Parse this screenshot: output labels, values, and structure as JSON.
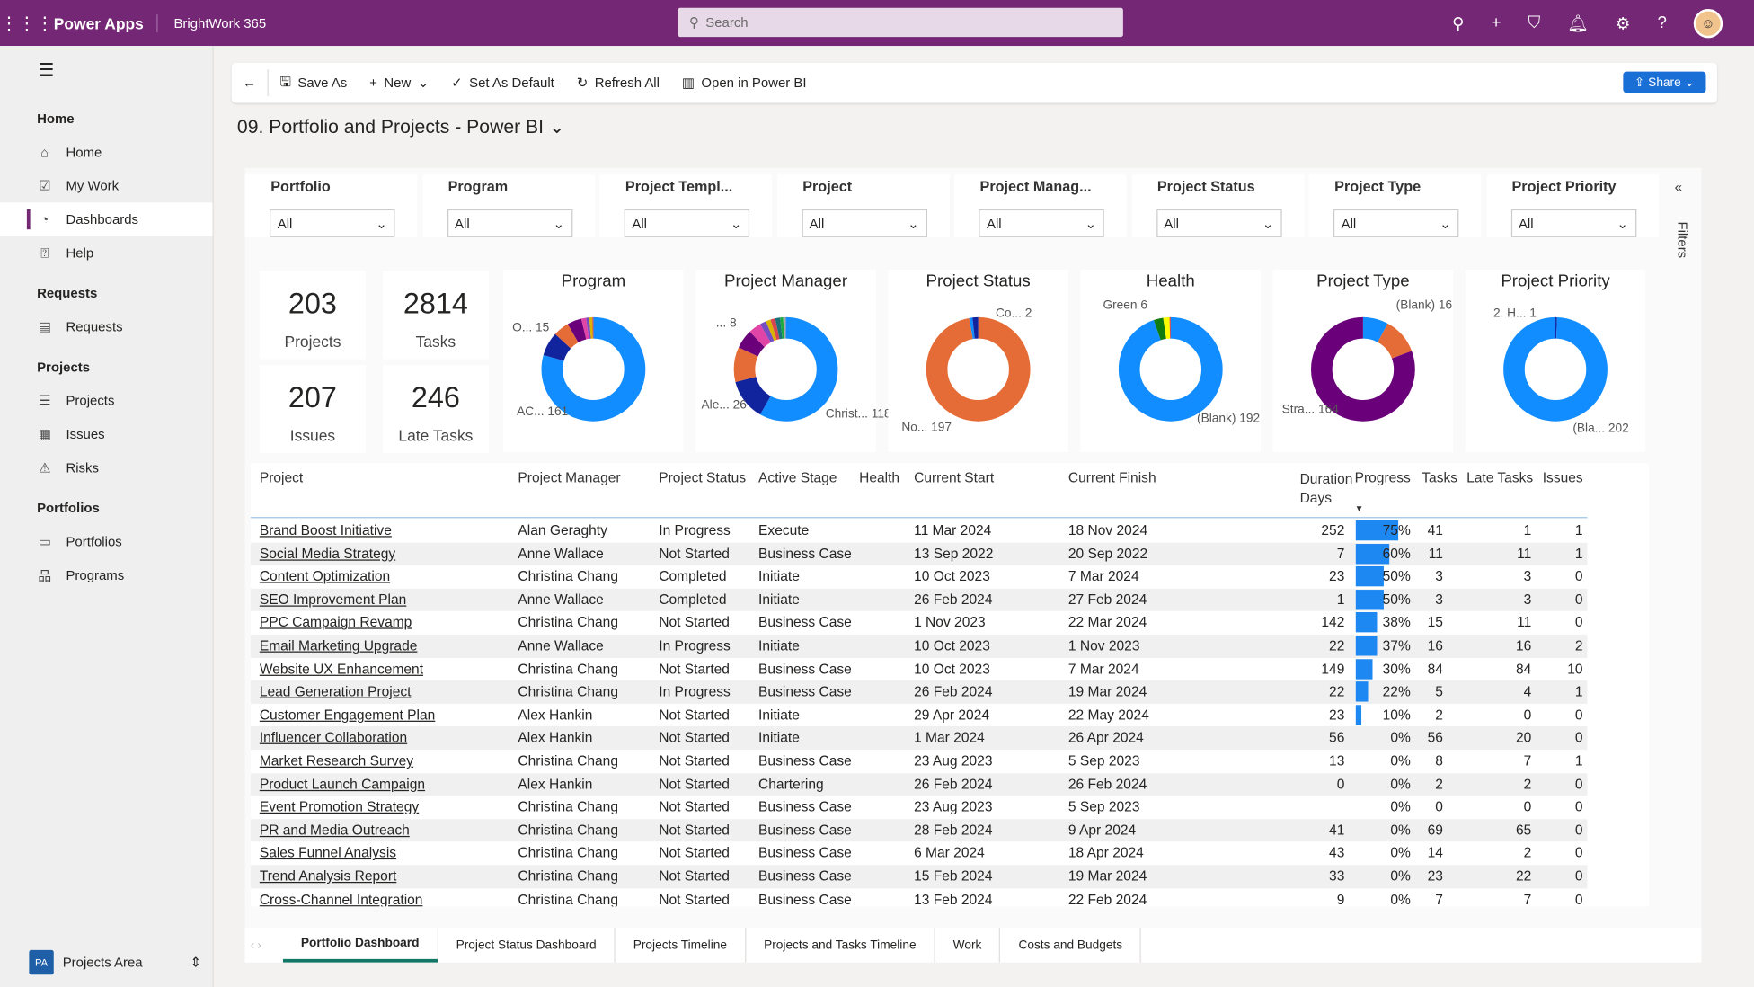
{
  "topbar": {
    "app": "Power Apps",
    "environment": "BrightWork 365",
    "search_placeholder": "Search"
  },
  "sidebar": {
    "groups": [
      {
        "title": "Home",
        "items": [
          {
            "label": "Home",
            "icon": "home-icon"
          },
          {
            "label": "My Work",
            "icon": "checkbox-icon"
          },
          {
            "label": "Dashboards",
            "icon": "dashboard-icon",
            "selected": true
          },
          {
            "label": "Help",
            "icon": "help-icon"
          }
        ]
      },
      {
        "title": "Requests",
        "items": [
          {
            "label": "Requests",
            "icon": "requests-icon"
          }
        ]
      },
      {
        "title": "Projects",
        "items": [
          {
            "label": "Projects",
            "icon": "projects-icon"
          },
          {
            "label": "Issues",
            "icon": "issues-icon"
          },
          {
            "label": "Risks",
            "icon": "warning-icon"
          }
        ]
      },
      {
        "title": "Portfolios",
        "items": [
          {
            "label": "Portfolios",
            "icon": "briefcase-icon"
          },
          {
            "label": "Programs",
            "icon": "hierarchy-icon"
          }
        ]
      }
    ],
    "area": {
      "badge": "PA",
      "label": "Projects Area"
    }
  },
  "toolbar": {
    "save_as": "Save As",
    "new": "New",
    "set_default": "Set As Default",
    "refresh_all": "Refresh All",
    "open_powerbi": "Open in Power BI",
    "share": "Share"
  },
  "page_title": "09. Portfolio and Projects - Power BI",
  "filters_label": "Filters",
  "slicers": [
    {
      "label": "Portfolio",
      "value": "All"
    },
    {
      "label": "Program",
      "value": "All"
    },
    {
      "label": "Project Templ...",
      "value": "All"
    },
    {
      "label": "Project",
      "value": "All"
    },
    {
      "label": "Project Manag...",
      "value": "All"
    },
    {
      "label": "Project Status",
      "value": "All"
    },
    {
      "label": "Project Type",
      "value": "All"
    },
    {
      "label": "Project Priority",
      "value": "All"
    }
  ],
  "cards": [
    {
      "value": "203",
      "label": "Projects"
    },
    {
      "value": "2814",
      "label": "Tasks"
    },
    {
      "value": "207",
      "label": "Issues"
    },
    {
      "value": "246",
      "label": "Late Tasks"
    }
  ],
  "chart_data": [
    {
      "type": "pie",
      "title": "Program",
      "values": [
        161,
        15,
        10,
        9,
        3,
        2,
        2,
        1
      ],
      "colors": [
        "#118dff",
        "#12239e",
        "#e66c37",
        "#6b007b",
        "#e044a7",
        "#744ec2",
        "#d9b300",
        "#d64550"
      ],
      "labels": [
        {
          "text": "AC...",
          "value": "161"
        },
        {
          "text": "O...",
          "value": "15"
        }
      ]
    },
    {
      "type": "pie",
      "title": "Project Manager",
      "values": [
        118,
        26,
        22,
        12,
        8,
        4,
        3,
        3,
        3,
        2,
        2
      ],
      "colors": [
        "#118dff",
        "#12239e",
        "#e66c37",
        "#6b007b",
        "#e044a7",
        "#744ec2",
        "#d9b300",
        "#d64550",
        "#197278",
        "#1aab40",
        "#aaaaaa"
      ],
      "labels": [
        {
          "text": "Christ...",
          "value": "118"
        },
        {
          "text": "Ale...",
          "value": "26"
        },
        {
          "text": "...",
          "value": "8"
        }
      ]
    },
    {
      "type": "pie",
      "title": "Project Status",
      "values": [
        197,
        2,
        4
      ],
      "colors": [
        "#e66c37",
        "#118dff",
        "#12239e"
      ],
      "labels": [
        {
          "text": "No...",
          "value": "197"
        },
        {
          "text": "Co...",
          "value": "2"
        }
      ]
    },
    {
      "type": "pie",
      "title": "Health",
      "values": [
        192,
        6,
        4,
        1
      ],
      "colors": [
        "#118dff",
        "#107c10",
        "#ffff00",
        "#d13438"
      ],
      "labels": [
        {
          "text": "(Blank)",
          "value": "192"
        },
        {
          "text": "Green",
          "value": "6"
        }
      ]
    },
    {
      "type": "pie",
      "title": "Project Type",
      "values": [
        16,
        23,
        164
      ],
      "colors": [
        "#118dff",
        "#e66c37",
        "#6b007b"
      ],
      "labels": [
        {
          "text": "Stra...",
          "value": "164"
        },
        {
          "text": "(Blank)",
          "value": "16"
        }
      ]
    },
    {
      "type": "pie",
      "title": "Project Priority",
      "values": [
        1,
        202
      ],
      "colors": [
        "#12239e",
        "#118dff"
      ],
      "labels": [
        {
          "text": "(Bla...",
          "value": "202"
        },
        {
          "text": "2. H...",
          "value": "1"
        }
      ]
    }
  ],
  "table": {
    "columns": [
      "Project",
      "Project Manager",
      "Project Status",
      "Active Stage",
      "Health",
      "Current Start",
      "Current Finish",
      "Duration Days",
      "Progress",
      "Tasks",
      "Late Tasks",
      "Issues"
    ],
    "rows": [
      [
        "Brand Boost Initiative",
        "Alan Geraghty",
        "In Progress",
        "Execute",
        "",
        "11 Mar 2024",
        "18 Nov 2024",
        "252",
        "75%",
        "41",
        "1",
        "1"
      ],
      [
        "Social Media Strategy",
        "Anne Wallace",
        "Not Started",
        "Business Case",
        "",
        "13 Sep 2022",
        "20 Sep 2022",
        "7",
        "60%",
        "11",
        "11",
        "1"
      ],
      [
        "Content Optimization",
        "Christina Chang",
        "Completed",
        "Initiate",
        "",
        "10 Oct 2023",
        "7 Mar 2024",
        "23",
        "50%",
        "3",
        "3",
        "0"
      ],
      [
        "SEO Improvement Plan",
        "Anne Wallace",
        "Completed",
        "Initiate",
        "",
        "26 Feb 2024",
        "27 Feb 2024",
        "1",
        "50%",
        "3",
        "3",
        "0"
      ],
      [
        "PPC Campaign Revamp",
        "Christina Chang",
        "Not Started",
        "Business Case",
        "",
        "1 Nov 2023",
        "22 Mar 2024",
        "142",
        "38%",
        "15",
        "11",
        "0"
      ],
      [
        "Email Marketing Upgrade",
        "Anne Wallace",
        "In Progress",
        "Initiate",
        "",
        "10 Oct 2023",
        "1 Nov 2023",
        "22",
        "37%",
        "16",
        "16",
        "2"
      ],
      [
        "Website UX Enhancement",
        "Christina Chang",
        "Not Started",
        "Business Case",
        "",
        "10 Oct 2023",
        "7 Mar 2024",
        "149",
        "30%",
        "84",
        "84",
        "10"
      ],
      [
        "Lead Generation Project",
        "Christina Chang",
        "In Progress",
        "Business Case",
        "",
        "26 Feb 2024",
        "19 Mar 2024",
        "22",
        "22%",
        "5",
        "4",
        "1"
      ],
      [
        "Customer Engagement Plan",
        "Alex Hankin",
        "Not Started",
        "Initiate",
        "",
        "29 Apr 2024",
        "22 May 2024",
        "23",
        "10%",
        "2",
        "0",
        "0"
      ],
      [
        "Influencer Collaboration",
        "Alex Hankin",
        "Not Started",
        "Initiate",
        "",
        "1 Mar 2024",
        "26 Apr 2024",
        "56",
        "0%",
        "56",
        "20",
        "0"
      ],
      [
        "Market Research Survey",
        "Christina Chang",
        "Not Started",
        "Business Case",
        "",
        "23 Aug 2023",
        "5 Sep 2023",
        "13",
        "0%",
        "8",
        "7",
        "1"
      ],
      [
        "Product Launch Campaign",
        "Alex Hankin",
        "Not Started",
        "Chartering",
        "",
        "26 Feb 2024",
        "26 Feb 2024",
        "0",
        "0%",
        "2",
        "2",
        "0"
      ],
      [
        "Event Promotion Strategy",
        "Christina Chang",
        "Not Started",
        "Business Case",
        "",
        "23 Aug 2023",
        "5 Sep 2023",
        "",
        "0%",
        "0",
        "0",
        "0"
      ],
      [
        "PR and Media Outreach",
        "Christina Chang",
        "Not Started",
        "Business Case",
        "",
        "28 Feb 2024",
        "9 Apr 2024",
        "41",
        "0%",
        "69",
        "65",
        "0"
      ],
      [
        "Sales Funnel Analysis",
        "Christina Chang",
        "Not Started",
        "Business Case",
        "",
        "6 Mar 2024",
        "18 Apr 2024",
        "43",
        "0%",
        "14",
        "2",
        "0"
      ],
      [
        "Trend Analysis Report",
        "Christina Chang",
        "Not Started",
        "Business Case",
        "",
        "15 Feb 2024",
        "19 Mar 2024",
        "33",
        "0%",
        "23",
        "22",
        "0"
      ],
      [
        "Cross-Channel Integration",
        "Christina Chang",
        "Not Started",
        "Business Case",
        "",
        "13 Feb 2024",
        "22 Feb 2024",
        "9",
        "0%",
        "7",
        "7",
        "0"
      ]
    ]
  },
  "tabs": [
    {
      "label": "Portfolio Dashboard",
      "selected": true
    },
    {
      "label": "Project Status Dashboard"
    },
    {
      "label": "Projects Timeline"
    },
    {
      "label": "Projects and Tasks Timeline"
    },
    {
      "label": "Work"
    },
    {
      "label": "Costs and Budgets"
    }
  ],
  "colors": {
    "header": "#742774",
    "accent": "#118dff"
  }
}
